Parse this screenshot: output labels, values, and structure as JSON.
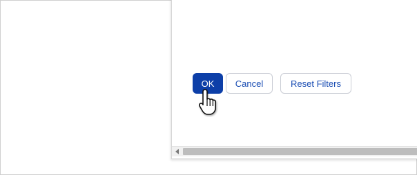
{
  "dialog": {
    "buttons": {
      "ok_label": "OK",
      "cancel_label": "Cancel",
      "reset_filters_label": "Reset Filters"
    }
  },
  "colors": {
    "primary": "#0d3fa8",
    "link_text": "#1a4db3",
    "border": "#c9ccd4",
    "scroll_thumb": "#bdbdbd"
  },
  "icons": {
    "cursor": "hand-pointer-icon",
    "scroll_left": "arrow-left-icon"
  }
}
